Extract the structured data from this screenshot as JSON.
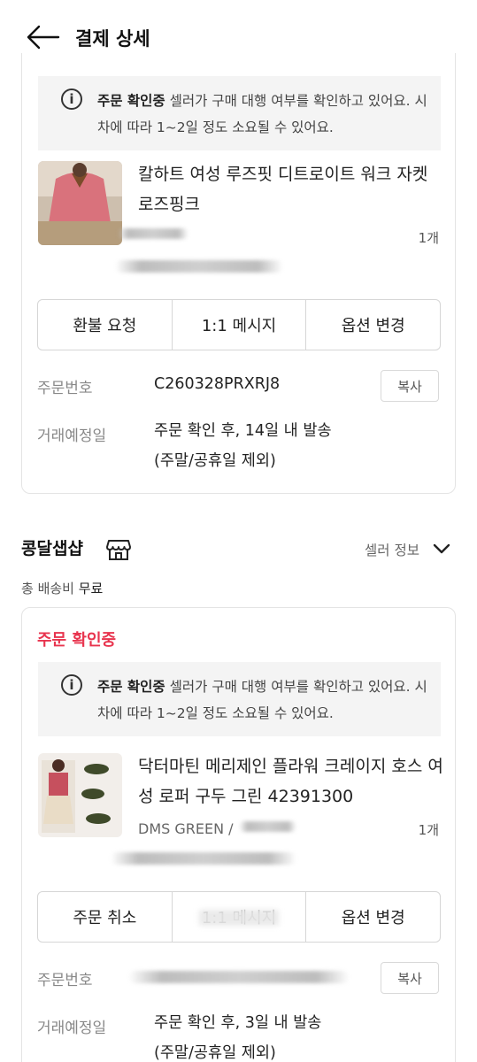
{
  "header": {
    "title": "결제 상세"
  },
  "order1": {
    "info_status": "주문 확인중",
    "info_message": " 셀러가 구매 대행 여부를 확인하고 있어요. 시차에 따라 1~2일 정도 소요될 수 있어요.",
    "product_name": "칼하트 여성 루즈핏 디트로이트 워크 자켓 로즈핑크",
    "quantity": "1개",
    "actions": [
      "환불 요청",
      "1:1 메시지",
      "옵션 변경"
    ],
    "order_number_label": "주문번호",
    "order_number": "C260328PRXRJ8",
    "copy_label": "복사",
    "schedule_label": "거래예정일",
    "schedule_line1": "주문 확인 후, 14일 내 발송",
    "schedule_line2": "(주말/공휴일 제외)"
  },
  "seller": {
    "name": "콩달샙샵",
    "info_label": "셀러 정보",
    "shipping_prefix": "총 배송비 ",
    "shipping_value": "무료"
  },
  "order2": {
    "status_title": "주문 확인중",
    "info_status": "주문 확인중",
    "info_message": " 셀러가 구매 대행 여부를 확인하고 있어요. 시차에 따라 1~2일 정도 소요될 수 있어요.",
    "product_name": "닥터마틴 메리제인 플라워 크레이지 호스 여성 로퍼 구두 그린 42391300",
    "option": "DMS GREEN /",
    "quantity": "1개",
    "actions": [
      "주문 취소",
      "1:1 메시지",
      "옵션 변경"
    ],
    "order_number_label": "주문번호",
    "copy_label": "복사",
    "schedule_label": "거래예정일",
    "schedule_line1": "주문 확인 후, 3일 내 발송",
    "schedule_line2": "(주말/공휴일 제외)"
  },
  "colors": {
    "accent": "#e8344e",
    "info_bg": "#f4f4f4",
    "border": "#e4e4e4"
  },
  "icons": [
    "back-arrow-icon",
    "info-icon",
    "shop-icon",
    "chevron-down-icon"
  ]
}
